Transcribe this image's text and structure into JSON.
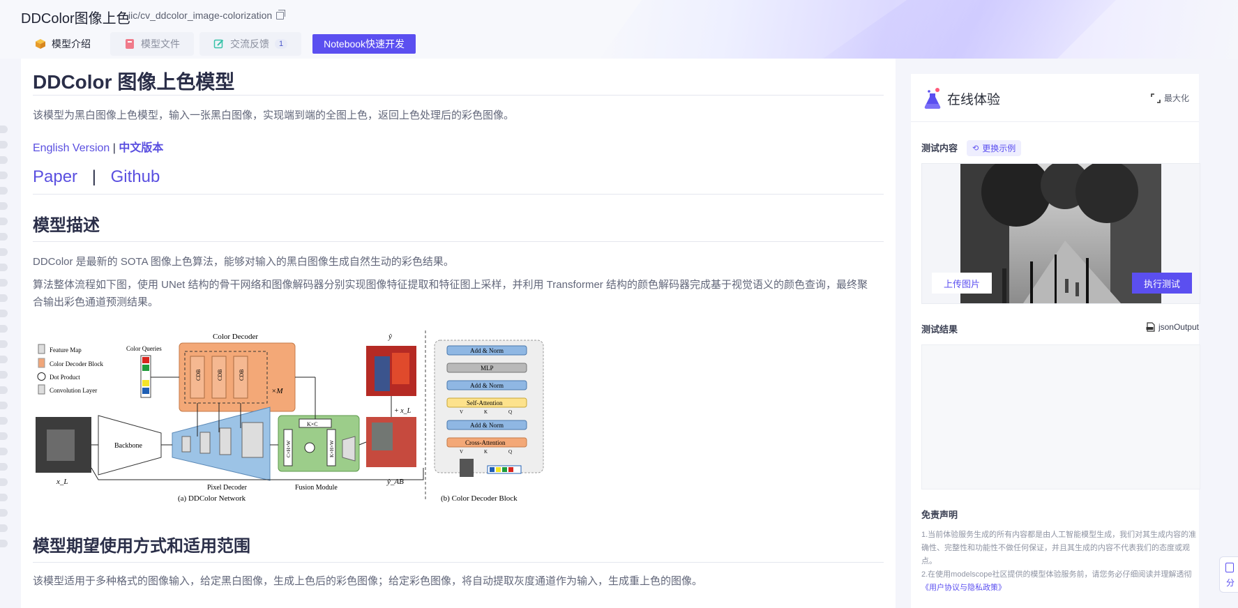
{
  "header": {
    "title": "DDColor图像上色",
    "repo": "iic/cv_ddcolor_image-colorization",
    "tabs": [
      {
        "label": "模型介绍"
      },
      {
        "label": "模型文件"
      },
      {
        "label": "交流反馈",
        "badge": "1"
      }
    ],
    "notebook_button": "Notebook快速开发"
  },
  "article": {
    "title": "DDColor 图像上色模型",
    "intro": "该模型为黑白图像上色模型，输入一张黑白图像，实现端到端的全图上色，返回上色处理后的彩色图像。",
    "lang_en": "English Version",
    "lang_sep": "|",
    "lang_cn": "中文版本",
    "paper": "Paper",
    "github": "Github",
    "big_sep": "|",
    "desc_heading": "模型描述",
    "desc_p1": "DDColor 是最新的 SOTA 图像上色算法，能够对输入的黑白图像生成自然生动的彩色结果。",
    "desc_p2": "算法整体流程如下图，使用 UNet 结构的骨干网络和图像解码器分别实现图像特征提取和特征图上采样，并利用 Transformer 结构的颜色解码器完成基于视觉语义的颜色查询，最终聚合输出彩色通道预测结果。",
    "usage_heading": "模型期望使用方式和适用范围",
    "usage_p": "该模型适用于多种格式的图像输入，给定黑白图像，生成上色后的彩色图像；给定彩色图像，将自动提取灰度通道作为输入，生成重上色的图像。"
  },
  "figure": {
    "legend": [
      "Feature Map",
      "Color Decoder Block",
      "Dot Product",
      "Convolution Layer"
    ],
    "color_queries": "Color Queries",
    "color_decoder": "Color Decoder",
    "cdb": "CDB",
    "xm": "×M",
    "backbone": "Backbone",
    "pixel_decoder": "Pixel Decoder",
    "fusion_module": "Fusion Module",
    "kxc": "K×C",
    "cxhxw": "C×H×W",
    "kxhxw": "K×H×W",
    "x_l": "x_L",
    "y_hat": "ŷ",
    "y_ab": "ŷ_AB",
    "plus_xl": "+ x_L",
    "caption_a": "(a) DDColor Network",
    "caption_b": "(b) Color Decoder Block",
    "block": {
      "add_norm": "Add & Norm",
      "mlp": "MLP",
      "self_attention": "Self-Attention",
      "cross_attention": "Cross-Attention",
      "v": "V",
      "k": "K",
      "q": "Q"
    }
  },
  "panel": {
    "title": "在线体验",
    "maximize": "最大化",
    "test_content": "测试内容",
    "swap_example": "更换示例",
    "upload": "上传图片",
    "run": "执行测试",
    "test_result": "测试结果",
    "json_output": "jsonOutput",
    "disclaimer_title": "免责声明",
    "disclaimer_1": "1.当前体验服务生成的所有内容都是由人工智能模型生成，我们对其生成内容的准确性、完整性和功能性不做任何保证，并且其生成的内容不代表我们的态度或观点。",
    "disclaimer_2": "2.在使用modelscope社区提供的模型体验服务前，请您务必仔细阅读并理解透彻",
    "disclaimer_link": "《用户协议与隐私政策》"
  },
  "side_widget": "分",
  "colors": {
    "accent": "#5b4ff0",
    "link": "#5a4fe0",
    "heading": "#2a2e48"
  }
}
